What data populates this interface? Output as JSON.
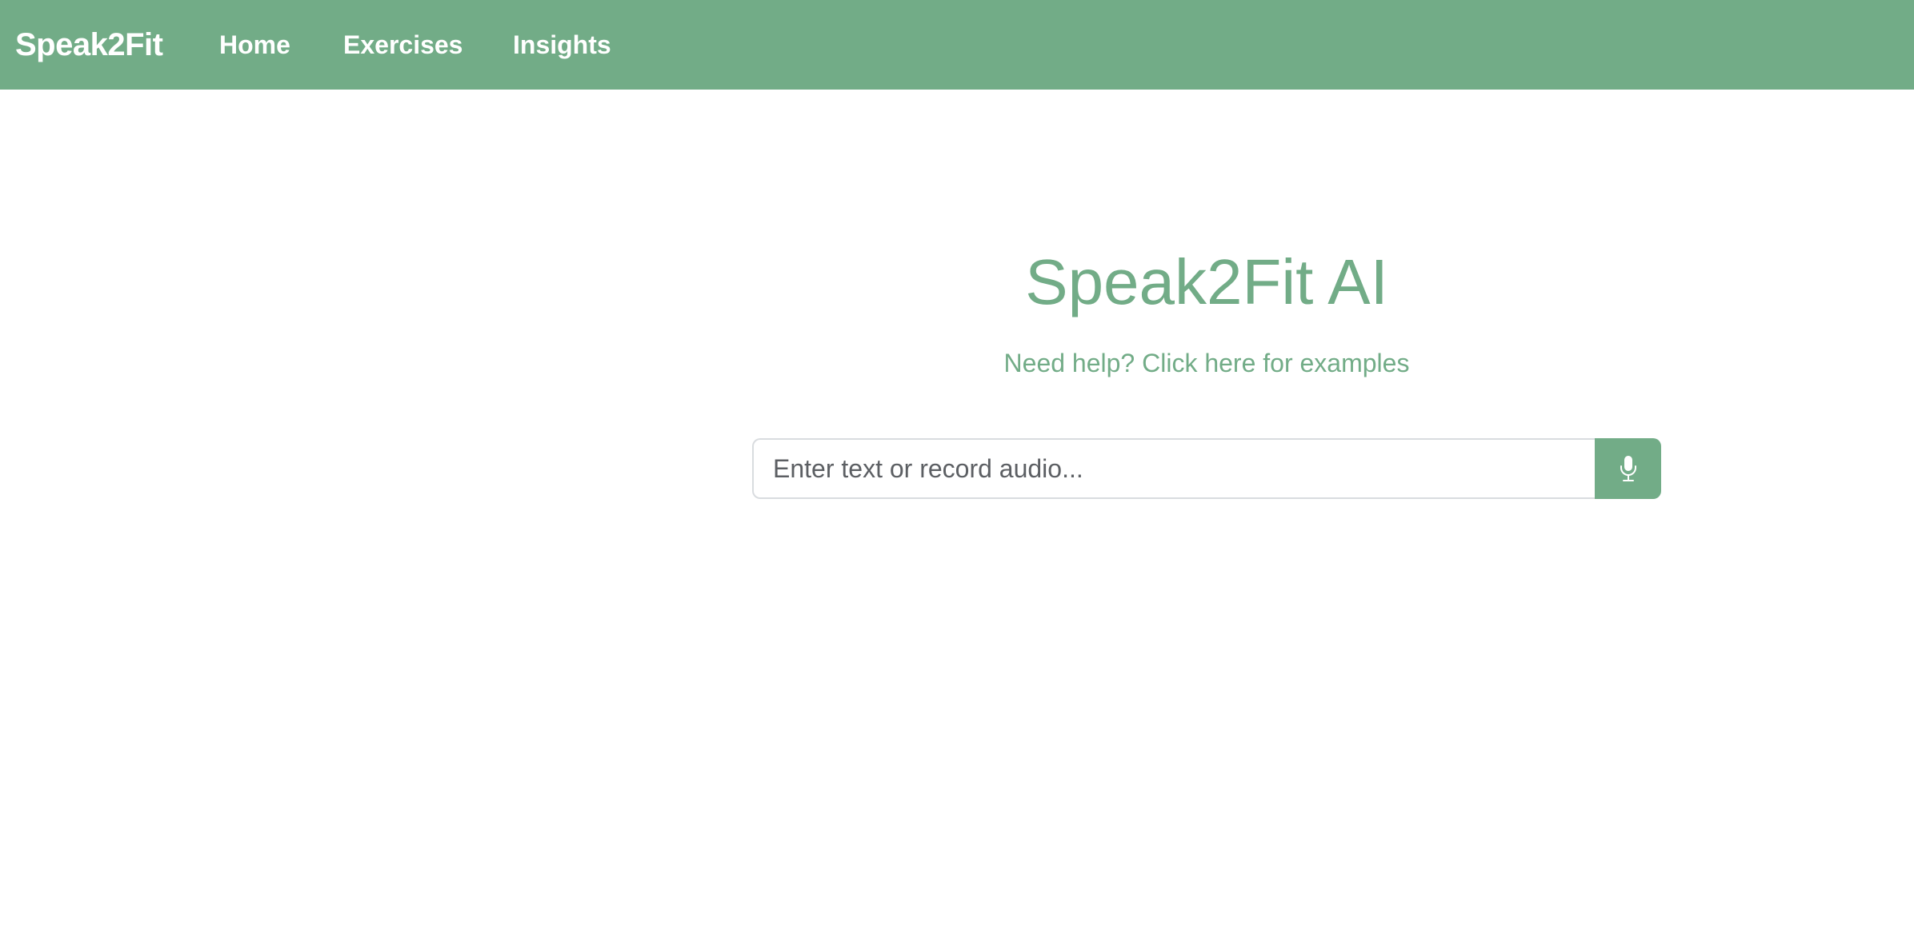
{
  "navbar": {
    "brand": "Speak2Fit",
    "links": [
      {
        "label": "Home"
      },
      {
        "label": "Exercises"
      },
      {
        "label": "Insights"
      }
    ],
    "background_color": "#72ac87"
  },
  "hero": {
    "title": "Speak2Fit AI",
    "help_link": "Need help? Click here for examples",
    "accent_color": "#72ac87"
  },
  "input": {
    "placeholder": "Enter text or record audio...",
    "value": ""
  },
  "mic_button": {
    "icon": "microphone-icon"
  }
}
